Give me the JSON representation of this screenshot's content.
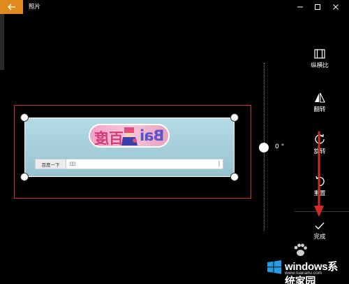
{
  "window": {
    "title": "照片",
    "accent_color": "#e08a1e"
  },
  "editor": {
    "rotation_value": "0 °",
    "photo": {
      "doodle_left_text": "百度",
      "doodle_right_text": "Bai",
      "search_button_label": "百度一下"
    }
  },
  "toolbar": {
    "items": [
      {
        "label": "纵横比",
        "icon": "aspect-ratio-icon"
      },
      {
        "label": "翻转",
        "icon": "flip-icon"
      },
      {
        "label": "旋转",
        "icon": "rotate-icon"
      },
      {
        "label": "重置",
        "icon": "reset-icon"
      },
      {
        "label": "完成",
        "icon": "checkmark-icon"
      }
    ]
  },
  "watermark": {
    "brand_text": "windows系统家园",
    "url_text": "www.ruanaitu.com"
  },
  "annotation_color": "#d42a2a"
}
